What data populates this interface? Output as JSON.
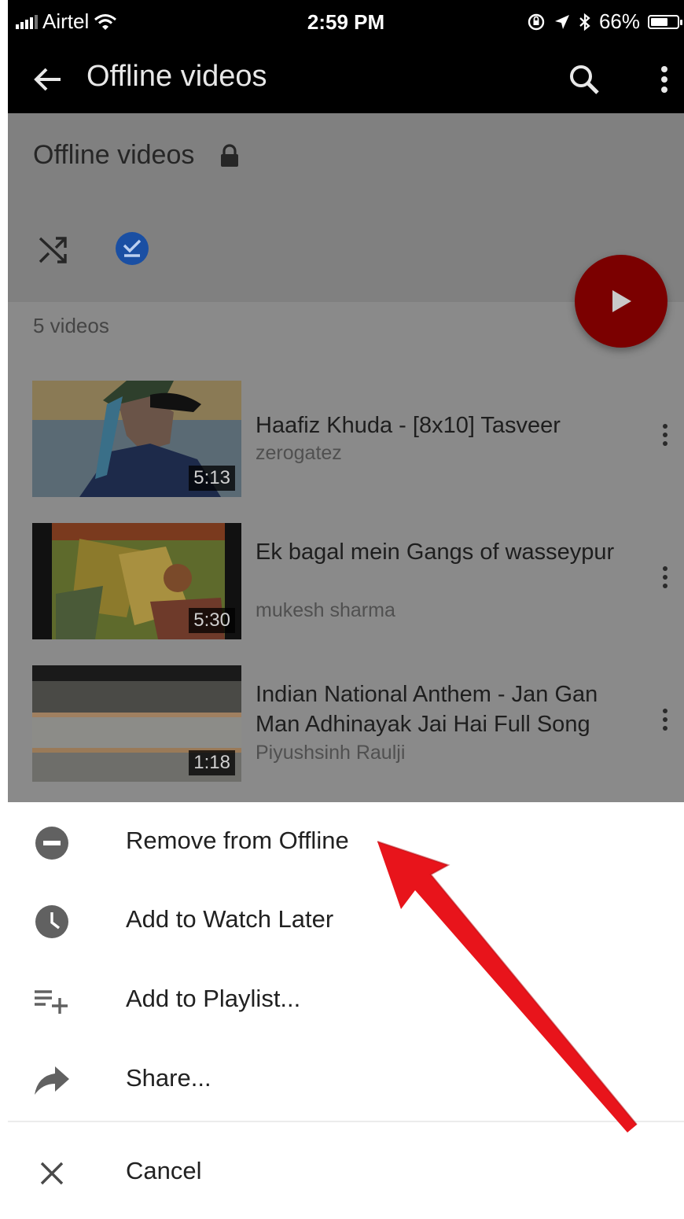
{
  "status_bar": {
    "carrier": "Airtel",
    "time": "2:59 PM",
    "battery": "66%",
    "battery_level": 0.66
  },
  "app_bar": {
    "title": "Offline videos",
    "icons": [
      "back-arrow-icon",
      "search-icon",
      "more-vert-icon"
    ]
  },
  "playlist": {
    "title": "Offline videos",
    "privacy_icon": "lock-icon",
    "actions": [
      "shuffle-icon",
      "downloaded-check-icon"
    ],
    "video_count": "5 videos",
    "play_all_icon": "play-icon"
  },
  "videos": [
    {
      "title": "Haafiz Khuda - [8x10] Tasveer",
      "channel": "zerogatez",
      "duration": "5:13"
    },
    {
      "title": "Ek bagal mein Gangs of wasseypur",
      "channel": "mukesh sharma",
      "duration": "5:30"
    },
    {
      "title": "Indian National Anthem - Jan Gan Man Adhinayak Jai Hai Full Song",
      "channel": "Piyushsinh Raulji",
      "duration": "1:18"
    }
  ],
  "sheet": {
    "items": [
      {
        "label": "Remove from Offline",
        "icon": "remove-circle-icon"
      },
      {
        "label": "Add to Watch Later",
        "icon": "clock-icon"
      },
      {
        "label": "Add to Playlist...",
        "icon": "playlist-add-icon"
      },
      {
        "label": "Share...",
        "icon": "share-icon"
      }
    ],
    "cancel": {
      "label": "Cancel",
      "icon": "close-icon"
    }
  },
  "colors": {
    "app_bar": "#000000",
    "dim_overlay": "#8a8a8a",
    "fab": "#7b0000",
    "check_badge": "#1a4fa3",
    "arrow": "#e8141b"
  }
}
